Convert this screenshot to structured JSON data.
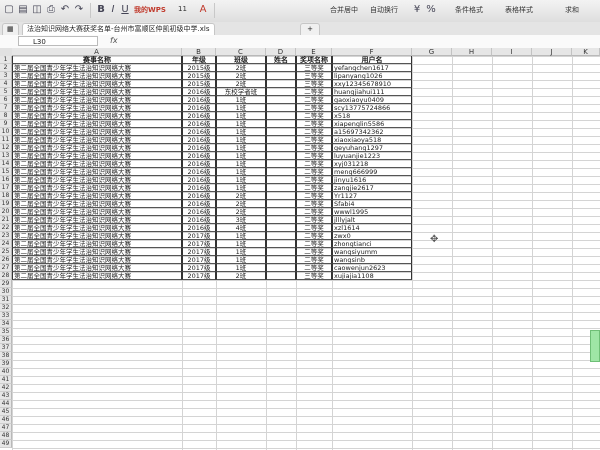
{
  "toolbar": {
    "wps_label": "我的WPS",
    "font_size_value": "11",
    "bold_glyph": "B",
    "italic_glyph": "I",
    "underline_glyph": "U",
    "merge_center_label": "合并居中",
    "wrap_text_label": "自动换行",
    "conditional_format_label": "条件格式",
    "table_style_label": "表格样式",
    "sum_label": "求和",
    "currency_glyph": "¥",
    "percent_glyph": "%"
  },
  "tabs": [
    {
      "label": "法治知识网络大赛获奖名单-台州市富顺区仲凯初级中学.xls"
    }
  ],
  "formula_bar": {
    "cell_ref": "L30",
    "fx": "fx",
    "value": ""
  },
  "columns": [
    "A",
    "B",
    "C",
    "D",
    "E",
    "F",
    "G",
    "H",
    "I",
    "J",
    "K"
  ],
  "table": {
    "headers": [
      "赛事名称",
      "年级",
      "班级",
      "姓名",
      "奖项名称",
      "用户名"
    ],
    "rows": [
      [
        "第二届全国青少年学生法治知识网络大赛",
        "2015级",
        "2班",
        "",
        "三等奖",
        "yefangchen1617"
      ],
      [
        "第二届全国青少年学生法治知识网络大赛",
        "2015级",
        "2班",
        "",
        "三等奖",
        "lipanyang1026"
      ],
      [
        "第二届全国青少年学生法治知识网络大赛",
        "2015级",
        "2班",
        "",
        "三等奖",
        "xxy12345678910"
      ],
      [
        "第二届全国青少年学生法治知识网络大赛",
        "2016级",
        "东校学者班",
        "",
        "二等奖",
        "huangjiahui111"
      ],
      [
        "第二届全国青少年学生法治知识网络大赛",
        "2016级",
        "1班",
        "",
        "二等奖",
        "gaoxiaoyu0409"
      ],
      [
        "第二届全国青少年学生法治知识网络大赛",
        "2016级",
        "1班",
        "",
        "二等奖",
        "scy13775724866"
      ],
      [
        "第二届全国青少年学生法治知识网络大赛",
        "2016级",
        "1班",
        "",
        "二等奖",
        "x518"
      ],
      [
        "第二届全国青少年学生法治知识网络大赛",
        "2016级",
        "1班",
        "",
        "二等奖",
        "xiapenglin5586"
      ],
      [
        "第二届全国青少年学生法治知识网络大赛",
        "2016级",
        "1班",
        "",
        "二等奖",
        "a15697342362"
      ],
      [
        "第二届全国青少年学生法治知识网络大赛",
        "2016级",
        "1班",
        "",
        "二等奖",
        "xiaoxiaoya518"
      ],
      [
        "第二届全国青少年学生法治知识网络大赛",
        "2016级",
        "1班",
        "",
        "二等奖",
        "geyuhang1297"
      ],
      [
        "第二届全国青少年学生法治知识网络大赛",
        "2016级",
        "1班",
        "",
        "二等奖",
        "luyuanjie1223"
      ],
      [
        "第二届全国青少年学生法治知识网络大赛",
        "2016级",
        "1班",
        "",
        "二等奖",
        "xyj031218"
      ],
      [
        "第二届全国青少年学生法治知识网络大赛",
        "2016级",
        "1班",
        "",
        "二等奖",
        "meng666999"
      ],
      [
        "第二届全国青少年学生法治知识网络大赛",
        "2016级",
        "1班",
        "",
        "二等奖",
        "jinyu1616"
      ],
      [
        "第二届全国青少年学生法治知识网络大赛",
        "2016级",
        "1班",
        "",
        "二等奖",
        "zangjie2617"
      ],
      [
        "第二届全国青少年学生法治知识网络大赛",
        "2016级",
        "2班",
        "",
        "二等奖",
        "Yr1127"
      ],
      [
        "第二届全国青少年学生法治知识网络大赛",
        "2016级",
        "2班",
        "",
        "二等奖",
        "Sfabi4"
      ],
      [
        "第二届全国青少年学生法治知识网络大赛",
        "2016级",
        "2班",
        "",
        "二等奖",
        "wwwl1995"
      ],
      [
        "第二届全国青少年学生法治知识网络大赛",
        "2016级",
        "3班",
        "",
        "二等奖",
        "jlllyjalt"
      ],
      [
        "第二届全国青少年学生法治知识网络大赛",
        "2016级",
        "4班",
        "",
        "二等奖",
        "xzl1614"
      ],
      [
        "第二届全国青少年学生法治知识网络大赛",
        "2017级",
        "1班",
        "",
        "二等奖",
        "zwx0"
      ],
      [
        "第二届全国青少年学生法治知识网络大赛",
        "2017级",
        "1班",
        "",
        "二等奖",
        "zhongtianci"
      ],
      [
        "第二届全国青少年学生法治知识网络大赛",
        "2017级",
        "1班",
        "",
        "二等奖",
        "wangsiyumm"
      ],
      [
        "第二届全国青少年学生法治知识网络大赛",
        "2017级",
        "1班",
        "",
        "二等奖",
        "wangsinb"
      ],
      [
        "第二届全国青少年学生法治知识网络大赛",
        "2017级",
        "1班",
        "",
        "二等奖",
        "caowenjun2623"
      ],
      [
        "第二届全国青少年学生法治知识网络大赛",
        "2017级",
        "2班",
        "",
        "三等奖",
        "xujiajia1108"
      ]
    ]
  },
  "row_numbers": [
    "1",
    "2",
    "3",
    "4",
    "5",
    "6",
    "7",
    "8",
    "9",
    "10",
    "11",
    "12",
    "13",
    "14",
    "15",
    "16",
    "17",
    "18",
    "19",
    "20",
    "21",
    "22",
    "23",
    "24",
    "25",
    "26",
    "27",
    "28",
    "29",
    "30",
    "31",
    "32",
    "33",
    "34",
    "35",
    "36",
    "37",
    "38",
    "39",
    "40",
    "41",
    "42",
    "43",
    "44",
    "45",
    "46",
    "47",
    "48",
    "49"
  ],
  "icons": {
    "new": "new-file-icon",
    "open": "folder-open-icon",
    "save": "save-icon",
    "print": "print-icon",
    "undo": "undo-icon",
    "redo": "redo-icon",
    "add_tab": "plus-icon"
  }
}
